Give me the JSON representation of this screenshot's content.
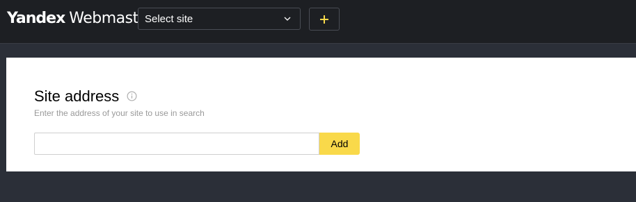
{
  "header": {
    "logo_brand": "Yandex",
    "logo_product": "Webmaster",
    "site_select_label": "Select site",
    "add_site_icon": "plus-icon"
  },
  "form": {
    "title": "Site address",
    "info_icon": "info-icon",
    "subtitle": "Enter the address of your site to use in search",
    "input_value": "",
    "input_placeholder": "",
    "add_label": "Add"
  },
  "colors": {
    "header_bg": "#1d1f23",
    "page_bg": "#2b2f38",
    "accent": "#f9d94a",
    "plus_icon": "#f9d94a"
  }
}
